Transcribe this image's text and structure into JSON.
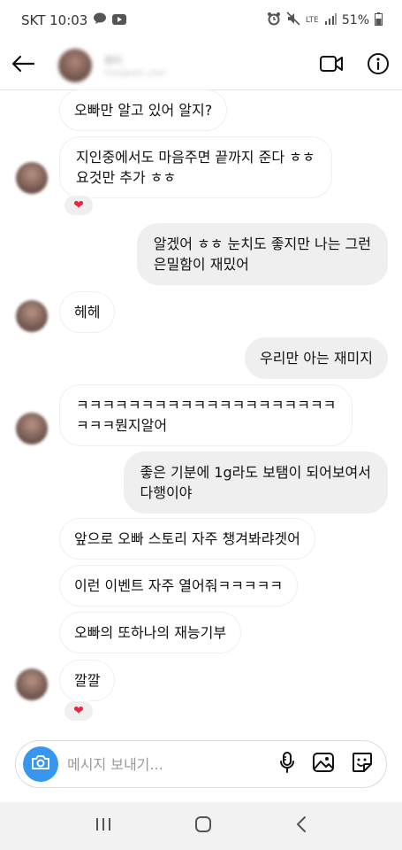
{
  "status_bar": {
    "carrier_time": "SKT 10:03",
    "network": "LTE",
    "battery": "51%"
  },
  "header": {
    "contact_name": "뭔터",
    "contact_sub": "instagram_user"
  },
  "messages": [
    {
      "text": "오빠만 알고 있어 알지?"
    },
    {
      "text": "지인중에서도 마음주면 끝까지 준다 ㅎㅎ\n요것만 추가 ㅎㅎ",
      "reaction": "❤"
    },
    {
      "text": "알겠어 ㅎㅎ 눈치도 좋지만 나는 그런\n은밀함이 재밌어"
    },
    {
      "text": "헤헤"
    },
    {
      "text": "우리만 아는 재미지"
    },
    {
      "text": "ㅋㅋㅋㅋㅋㅋㅋㅋㅋㅋㅋㅋㅋㅋㅋㅋㅋㅋㅋㅋ\nㅋㅋㅋ뭔지알어"
    },
    {
      "text": "좋은 기분에 1g라도 보탬이 되어보여서\n다행이야"
    },
    {
      "text": "앞으로 오빠 스토리 자주 챙겨봐랴겟어"
    },
    {
      "text": "이런 이벤트 자주 열어줘ㅋㅋㅋㅋㅋ"
    },
    {
      "text": "오빠의 또하나의 재능기부"
    },
    {
      "text": "깔깔",
      "reaction": "❤"
    }
  ],
  "composer": {
    "placeholder": "메시지 보내기..."
  },
  "icons": {
    "back": "back-arrow-icon",
    "video": "video-call-icon",
    "info": "info-icon",
    "camera": "camera-icon",
    "mic": "microphone-icon",
    "gallery": "gallery-icon",
    "sticker": "sticker-icon",
    "nav_recent": "recent-apps-icon",
    "nav_home": "home-icon",
    "nav_back": "back-icon"
  },
  "colors": {
    "accent": "#3797f0",
    "reaction": "#ed2443",
    "bubble_out": "#efefef"
  }
}
